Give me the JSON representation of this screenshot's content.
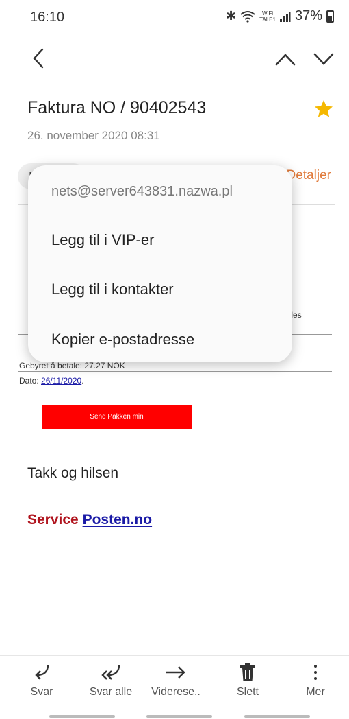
{
  "status": {
    "time": "16:10",
    "wifi_top": "WiFi",
    "wifi_bottom": "TALE1",
    "battery": "37%"
  },
  "email": {
    "subject": "Faktura NO / 90402543",
    "date": "26. november 2020  08:31",
    "sender_chip": "F",
    "details": "Detaljer"
  },
  "body": {
    "partial_text": "deles",
    "fee": "Gebyret å betale: 27.27 NOK",
    "date_label": "Dato: ",
    "date_link": "26/11/2020",
    "date_suffix": ".",
    "button": "Send Pakken min",
    "greeting": "Takk og hilsen",
    "service": "Service",
    "posten_link": "Posten.no"
  },
  "popup": {
    "email": "nets@server643831.nazwa.pl",
    "items": [
      "Legg til i VIP-er",
      "Legg til i kontakter",
      "Kopier e-postadresse"
    ]
  },
  "actions": [
    {
      "icon": "reply-icon",
      "label": "Svar"
    },
    {
      "icon": "reply-all-icon",
      "label": "Svar alle"
    },
    {
      "icon": "forward-icon",
      "label": "Viderese.."
    },
    {
      "icon": "trash-icon",
      "label": "Slett"
    },
    {
      "icon": "more-icon",
      "label": "Mer"
    }
  ],
  "colors": {
    "accent": "#e07a3a",
    "star": "#f5b800",
    "button_red": "#ff0000",
    "service_red": "#b0141e",
    "link_blue": "#1a1aa6"
  }
}
